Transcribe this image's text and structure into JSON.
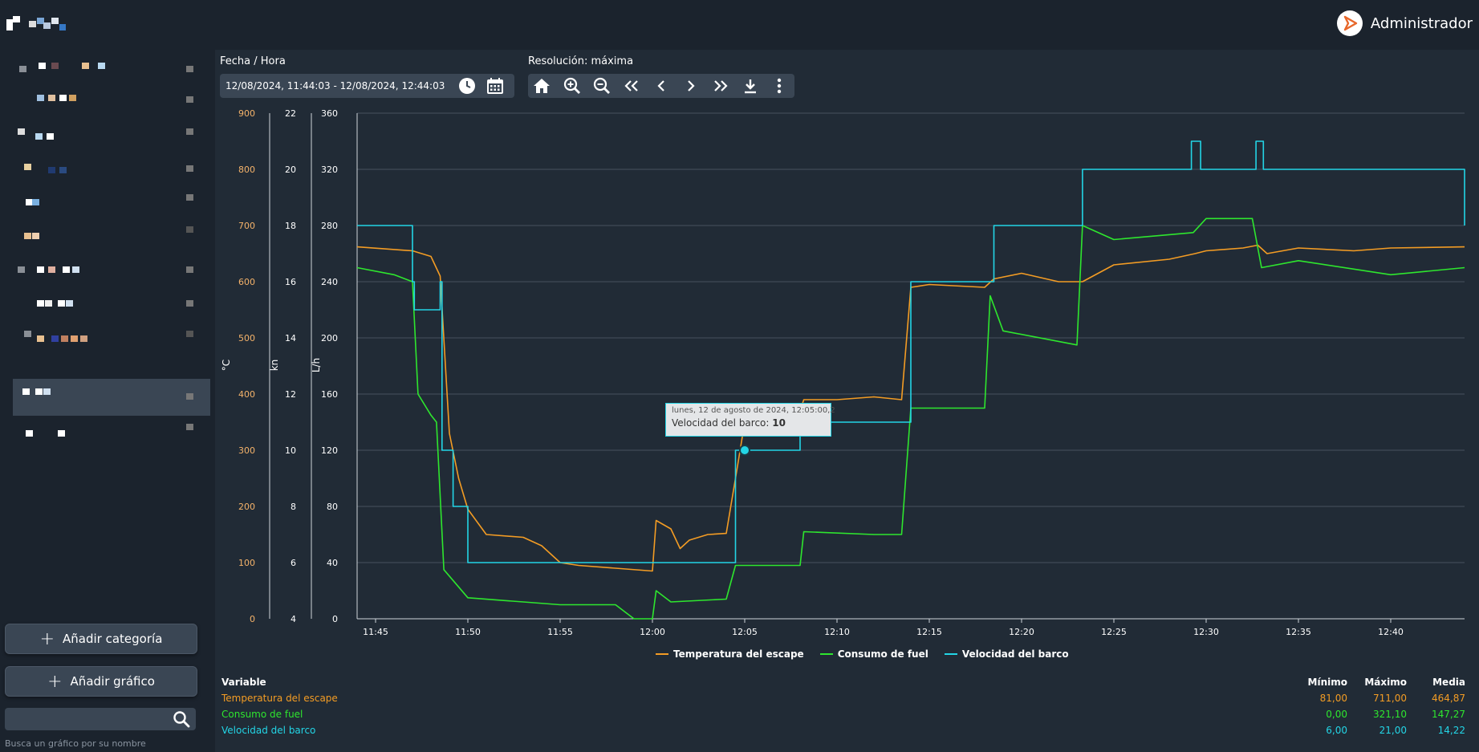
{
  "header": {
    "user_name": "Administrador",
    "user_icon": "play-logo-icon"
  },
  "sidebar": {
    "add_category_label": "Añadir categoría",
    "add_chart_label": "Añadir gráfico",
    "search_placeholder": "",
    "search_hint": "Busca un gráfico por su nombre"
  },
  "controls": {
    "date_label": "Fecha / Hora",
    "date_value": "12/08/2024, 11:44:03 - 12/08/2024, 12:44:03",
    "resolution_label": "Resolución: máxima"
  },
  "tooltip": {
    "date": "lunes, 12 de agosto de 2024, 12:05:00,2",
    "series": "Velocidad del barco: ",
    "value": "10"
  },
  "colors": {
    "temperature": "#f39c24",
    "fuel": "#2ee62e",
    "speed": "#23d5e6"
  },
  "chart_data": {
    "type": "line",
    "x_unit": "time",
    "x_ticks": [
      "11:45",
      "11:50",
      "11:55",
      "12:00",
      "12:05",
      "12:10",
      "12:15",
      "12:20",
      "12:25",
      "12:30",
      "12:35",
      "12:40"
    ],
    "y_axes": [
      {
        "label": "°C",
        "min": 0,
        "max": 900,
        "ticks": [
          0,
          100,
          200,
          300,
          400,
          500,
          600,
          700,
          800,
          900
        ]
      },
      {
        "label": "kn",
        "min": 4,
        "max": 22,
        "ticks": [
          4,
          6,
          8,
          10,
          12,
          14,
          16,
          18,
          20,
          22
        ]
      },
      {
        "label": "L/h",
        "min": 0,
        "max": 360,
        "ticks": [
          0,
          40,
          80,
          120,
          160,
          200,
          240,
          280,
          320,
          360
        ]
      }
    ],
    "series": [
      {
        "name": "Temperatura del escape",
        "axis": 0,
        "x": [
          "11:44",
          "11:47",
          "11:48",
          "11:48.5",
          "11:49",
          "11:49.5",
          "11:50",
          "11:51",
          "11:53",
          "11:54",
          "11:55",
          "11:56",
          "11:58",
          "12:00",
          "12:00.2",
          "12:01",
          "12:01.5",
          "12:02",
          "12:03",
          "12:04",
          "12:04.5",
          "12:05",
          "12:06",
          "12:08",
          "12:08.2",
          "12:10",
          "12:12",
          "12:13.5",
          "12:14",
          "12:15",
          "12:18",
          "12:18.5",
          "12:20",
          "12:22",
          "12:23.3",
          "12:25",
          "12:28",
          "12:29.4",
          "12:30",
          "12:32",
          "12:32.8",
          "12:33.3",
          "12:35",
          "12:38",
          "12:40",
          "12:44"
        ],
        "y": [
          662,
          655,
          645,
          610,
          330,
          250,
          195,
          150,
          145,
          130,
          100,
          95,
          90,
          85,
          175,
          160,
          125,
          140,
          150,
          152,
          250,
          350,
          360,
          370,
          390,
          390,
          395,
          390,
          590,
          595,
          590,
          605,
          615,
          600,
          600,
          630,
          640,
          650,
          655,
          660,
          665,
          650,
          660,
          655,
          660,
          662
        ]
      },
      {
        "name": "Consumo de fuel",
        "axis": 2,
        "x": [
          "11:44",
          "11:46",
          "11:47",
          "11:47.3",
          "11:48",
          "11:48.3",
          "11:48.7",
          "11:50",
          "11:52",
          "11:53",
          "11:55",
          "11:58",
          "11:59",
          "12:00",
          "12:00.2",
          "12:01",
          "12:04",
          "12:04.5",
          "12:05",
          "12:08",
          "12:08.2",
          "12:12",
          "12:13.5",
          "12:14",
          "12:18",
          "12:18.3",
          "12:19",
          "12:23",
          "12:23.3",
          "12:25",
          "12:29.3",
          "12:30",
          "12:32.5",
          "12:33",
          "12:35",
          "12:40",
          "12:44"
        ],
        "y": [
          250,
          245,
          240,
          160,
          145,
          140,
          35,
          15,
          13,
          12,
          10,
          10,
          0,
          0,
          20,
          12,
          14,
          38,
          38,
          38,
          62,
          60,
          60,
          150,
          150,
          230,
          205,
          195,
          280,
          270,
          275,
          285,
          285,
          250,
          255,
          245,
          250
        ]
      },
      {
        "name": "Velocidad del barco",
        "axis": 1,
        "x": [
          "11:44",
          "11:46.5",
          "11:47",
          "11:47.1",
          "11:48.5",
          "11:48.6",
          "11:49.2",
          "11:49.7",
          "11:50",
          "12:00",
          "12:00.1",
          "12:04",
          "12:04.5",
          "12:08",
          "12:14",
          "12:18.5",
          "12:23.3",
          "12:29.2",
          "12:29.7",
          "12:32.7",
          "12:33.1",
          "12:44"
        ],
        "y": [
          18,
          18,
          16,
          15,
          16,
          10,
          8,
          8,
          6,
          6,
          6,
          6,
          10,
          11,
          16,
          18,
          20,
          21,
          20,
          21,
          20,
          18
        ]
      }
    ],
    "stats": {
      "headers": [
        "Variable",
        "Mínimo",
        "Máximo",
        "Media"
      ],
      "rows": [
        {
          "name": "Temperatura del escape",
          "min": "81,00",
          "max": "711,00",
          "mean": "464,87"
        },
        {
          "name": "Consumo de fuel",
          "min": "0,00",
          "max": "321,10",
          "mean": "147,27"
        },
        {
          "name": "Velocidad del barco",
          "min": "6,00",
          "max": "21,00",
          "mean": "14,22"
        }
      ]
    }
  }
}
